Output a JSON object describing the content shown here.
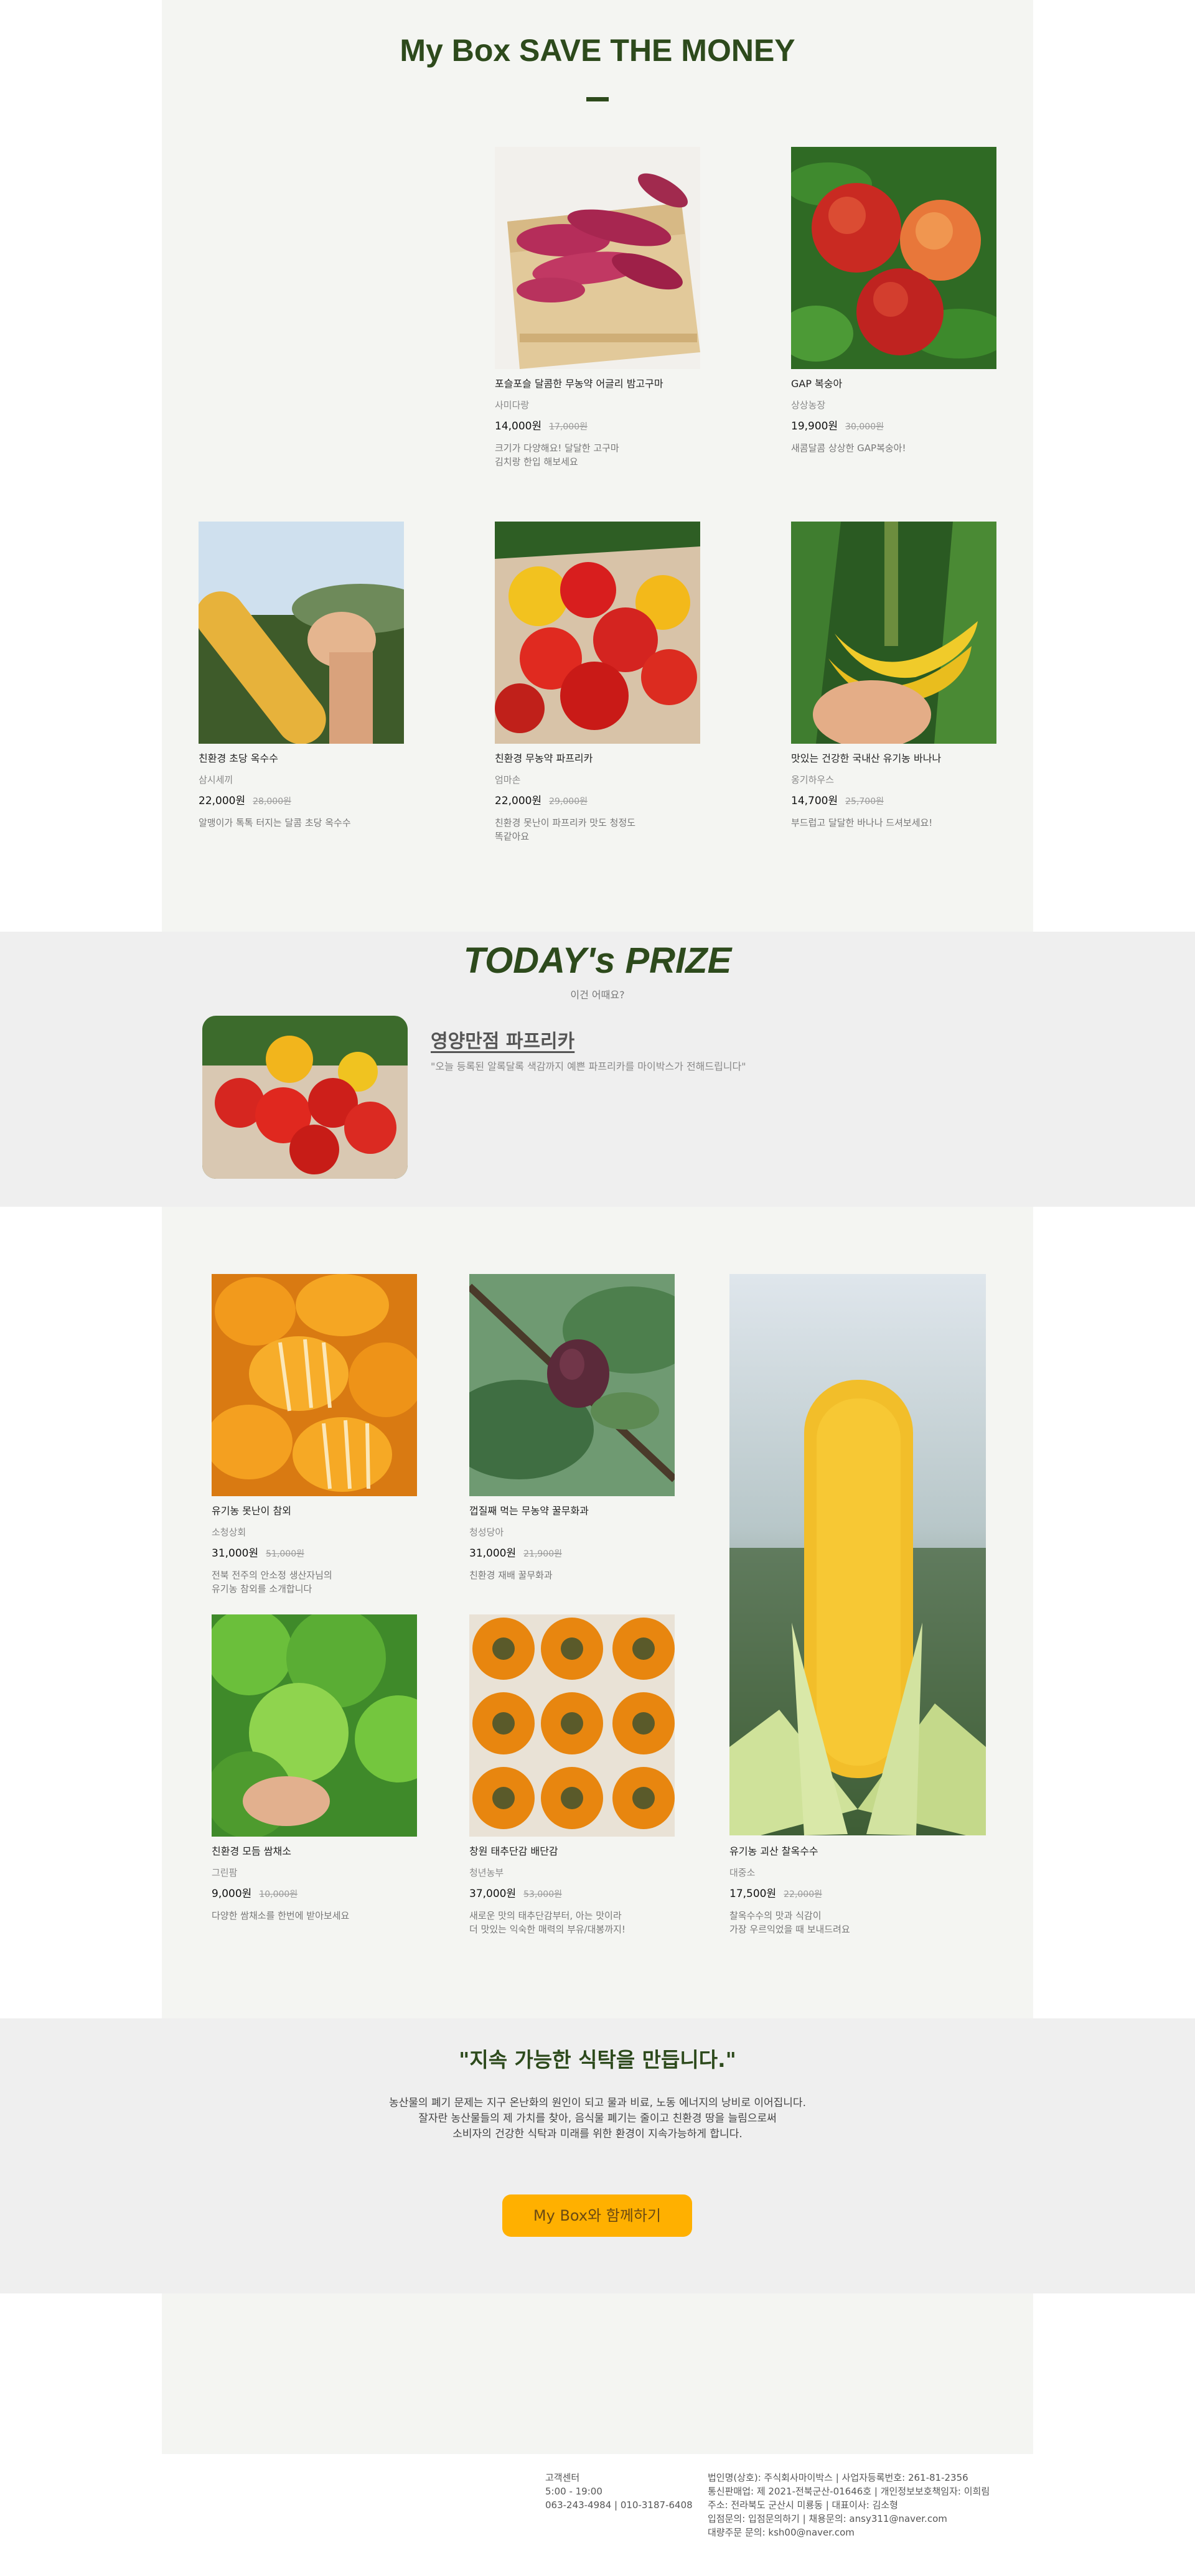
{
  "section_my_box": {
    "title": "My Box SAVE THE MONEY",
    "products": [
      {
        "name": "포슬포슬 달콤한 무농약 어글리 밤고구마",
        "farm": "사미다랑",
        "price": "14,000원",
        "orig_price": "17,000원",
        "desc": "크기가 다양해요! 달달한 고구마\n김치랑 한입 해보세요",
        "image": "sweet-potato-crate"
      },
      {
        "name": "GAP 복숭아",
        "farm": "상상농장",
        "price": "19,900원",
        "orig_price": "30,000원",
        "desc": "새콤달콤 상상한 GAP복숭아!",
        "image": "red-peaches"
      },
      {
        "name": "친환경 초당 옥수수",
        "farm": "삼시세끼",
        "price": "22,000원",
        "orig_price": "28,000원",
        "desc": "알맹이가 톡톡 터지는 달콤 초당 옥수수",
        "image": "corn-in-hand"
      },
      {
        "name": "친환경 무농약 파프리카",
        "farm": "엄마손",
        "price": "22,000원",
        "orig_price": "29,000원",
        "desc": "친환경 못난이 파프리카 맛도 청정도\n똑같아요",
        "image": "paprika-bag"
      },
      {
        "name": "맛있는 건강한 국내산 유기농 바나나",
        "farm": "옹기하우스",
        "price": "14,700원",
        "orig_price": "25,700원",
        "desc": "부드럽고 달달한 바나나 드셔보세요!",
        "image": "bananas-in-hand"
      }
    ]
  },
  "section_prize": {
    "title": "TODAY's PRIZE",
    "subtitle": "이건 어때요?",
    "name": "영양만점 파프리카",
    "desc": "\"오늘 등록된 알록달록 색감까지 예쁜 파프리카를 마이박스가 전해드립니다\"",
    "image": "paprika-pile"
  },
  "section_more": {
    "products": [
      {
        "name": "유기농 못난이 참외",
        "farm": "소청상회",
        "price": "31,000원",
        "orig_price": "51,000원",
        "desc": "전북 전주의 안소정 생산자님의\n유기농 참외를 소개합니다",
        "image": "korean-melons"
      },
      {
        "name": "껍질째 먹는 무농약 꿀무화과",
        "farm": "청성당아",
        "price": "31,000원",
        "orig_price": "21,900원",
        "desc": "친환경 재배 꿀무화과",
        "image": "fig-on-branch"
      },
      {
        "name": "친환경 모듬 쌈채소",
        "farm": "그린팜",
        "price": "9,000원",
        "orig_price": "10,000원",
        "desc": "다양한 쌈채소를 한번에 받아보세요",
        "image": "lettuce-field"
      },
      {
        "name": "창원 태추단감 배단감",
        "farm": "청년농부",
        "price": "37,000원",
        "orig_price": "53,000원",
        "desc": "새로운 맛의 태추단감부터, 아는 맛이라\n더 맛있는 익숙한 매력의 부유/대봉까지!",
        "image": "persimmons-grid"
      },
      {
        "name": "유기농 괴산 찰옥수수",
        "farm": "대중소",
        "price": "17,500원",
        "orig_price": "22,000원",
        "desc": "찰옥수수의 맛과 식감이\n가장 우르익었을 때 보내드려요",
        "image": "corn-closeup"
      }
    ]
  },
  "section_mission": {
    "quote": "\"지속 가능한 식탁을 만듭니다.\"",
    "lines": [
      "농산물의 폐기 문제는 지구 온난화의 원인이 되고 물과 비료, 노동 에너지의 낭비로 이어집니다.",
      "잘자란 농산물들의 제 가치를 찾아, 음식물 폐기는 줄이고 친환경 땅을 늘림으로써",
      "소비자의 건강한 식탁과 미래를 위한 환경이 지속가능하게 합니다."
    ],
    "cta_label": "My Box와 함께하기"
  },
  "footer": {
    "cs": [
      "고객센터",
      "5:00 - 19:00",
      "063-243-4984 | 010-3187-6408"
    ],
    "company": [
      "법인명(상호): 주식회사마이박스 | 사업자등록번호: 261-81-2356",
      "통신판매업: 제 2021-전북군산-01646호 | 개인정보보호책임자: 이희림",
      "주소: 전라북도 군산시 미룡동 | 대표이사: 김소형",
      "입점문의: 입점문의하기 | 채용문의: ansy311@naver.com",
      "대량주문 문의: ksh00@naver.com"
    ]
  },
  "colors": {
    "accent_green": "#2d4a1c",
    "cta_yellow": "#ffb000",
    "panel_bg": "#f4f5f2",
    "band_bg": "#efefef"
  }
}
